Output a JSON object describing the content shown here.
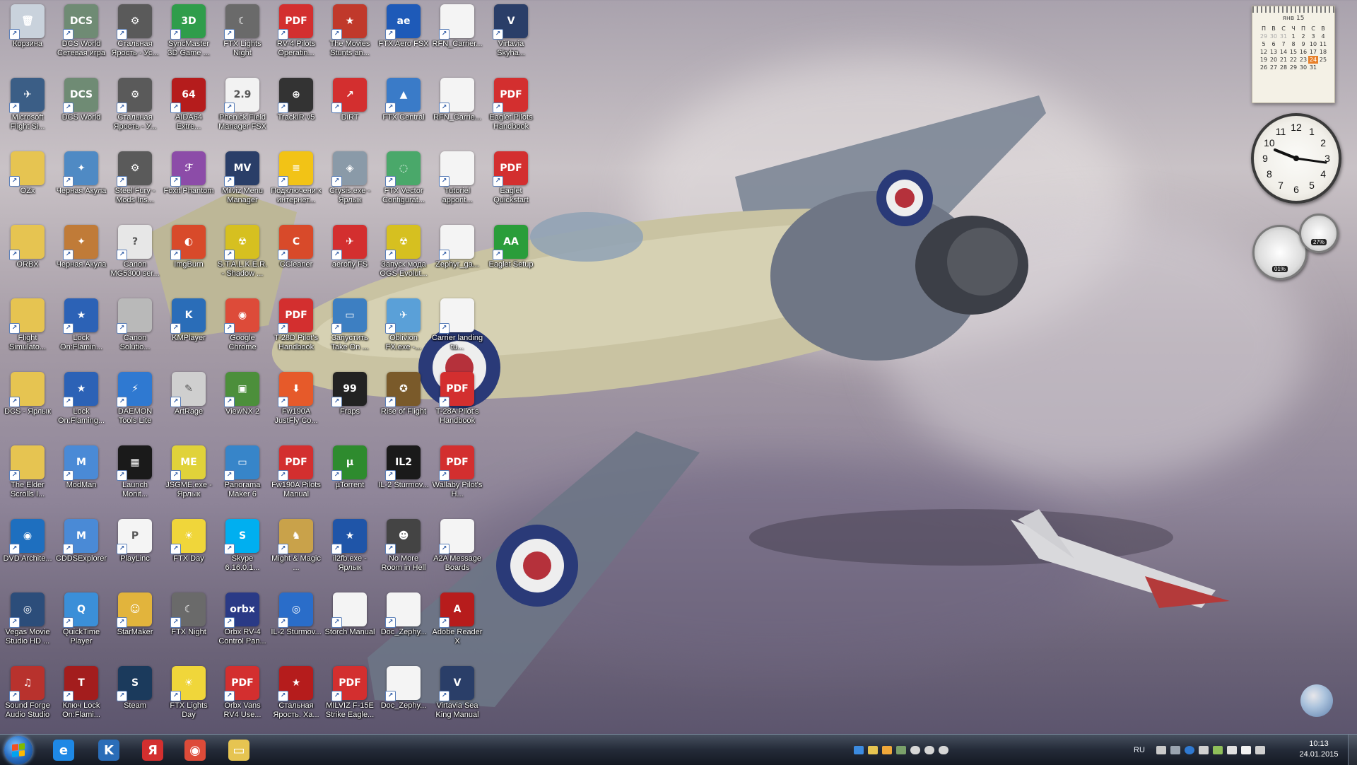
{
  "desktop": {
    "icons": [
      {
        "label": "Корзина",
        "color": "#c9d2dc",
        "glyph": "🗑"
      },
      {
        "label": "Microsoft Flight Si...",
        "color": "#3b5e86",
        "glyph": "✈"
      },
      {
        "label": "OZx",
        "color": "#e6c451",
        "glyph": ""
      },
      {
        "label": "ORBX",
        "color": "#e6c451",
        "glyph": ""
      },
      {
        "label": "Flight Simulato...",
        "color": "#e6c451",
        "glyph": ""
      },
      {
        "label": "DCS - Ярлык",
        "color": "#e6c451",
        "glyph": ""
      },
      {
        "label": "The Elder Scrolls I...",
        "color": "#e6c451",
        "glyph": ""
      },
      {
        "label": "DVD Archite...",
        "color": "#1e6fbf",
        "glyph": "◉"
      },
      {
        "label": "Vegas Movie Studio HD ...",
        "color": "#2c4d7a",
        "glyph": "◎"
      },
      {
        "label": "Sound Forge Audio Studio",
        "color": "#b8322d",
        "glyph": "♫"
      },
      {
        "label": "DCS World Сетевая игра",
        "color": "#6f8b74",
        "glyph": "DCS"
      },
      {
        "label": "DCS World",
        "color": "#6f8b74",
        "glyph": "DCS"
      },
      {
        "label": "Черная Акула",
        "color": "#4f8ac4",
        "glyph": "✦"
      },
      {
        "label": "Черная Акула",
        "color": "#c07b38",
        "glyph": "✦"
      },
      {
        "label": "Lock On:Flamin...",
        "color": "#2c62b6",
        "glyph": "★"
      },
      {
        "label": "Lock On:Flaming...",
        "color": "#2c62b6",
        "glyph": "★"
      },
      {
        "label": "ModMan",
        "color": "#4a8ad6",
        "glyph": "M"
      },
      {
        "label": "CDDSExplorer",
        "color": "#4a8ad6",
        "glyph": "M"
      },
      {
        "label": "QuickTime Player",
        "color": "#3b8fd8",
        "glyph": "Q"
      },
      {
        "label": "Ключ Lock On:Flami...",
        "color": "#a31d1d",
        "glyph": "T"
      },
      {
        "label": "Стальная Ярость - Ус...",
        "color": "#5a5a5a",
        "glyph": "⚙"
      },
      {
        "label": "Стальная Ярость - У...",
        "color": "#5a5a5a",
        "glyph": "⚙"
      },
      {
        "label": "Steel Fury - Mods Ins...",
        "color": "#5a5a5a",
        "glyph": "⚙"
      },
      {
        "label": "Canon MG5300 ser...",
        "color": "#e7e7e7",
        "glyph": "?"
      },
      {
        "label": "Canon Solutio...",
        "color": "#b9b9b9",
        "glyph": ""
      },
      {
        "label": "DAEMON Tools Lite",
        "color": "#2f79d1",
        "glyph": "⚡"
      },
      {
        "label": "Launch Monit...",
        "color": "#1a1a1a",
        "glyph": "▦"
      },
      {
        "label": "PlayLinc",
        "color": "#f4f4f4",
        "glyph": "P"
      },
      {
        "label": "StarMaker",
        "color": "#e2b43c",
        "glyph": "☺"
      },
      {
        "label": "Steam",
        "color": "#1b3a5c",
        "glyph": "S"
      },
      {
        "label": "SyncMaster 3D Game ...",
        "color": "#2f9d4b",
        "glyph": "3D"
      },
      {
        "label": "AIDA64 Extre...",
        "color": "#b51c1c",
        "glyph": "64"
      },
      {
        "label": "Foxit Phantom",
        "color": "#8c4ca8",
        "glyph": "ℱ"
      },
      {
        "label": "ImgBurn",
        "color": "#d84a2a",
        "glyph": "◐"
      },
      {
        "label": "KMPlayer",
        "color": "#2a6db8",
        "glyph": "K"
      },
      {
        "label": "ArtRage",
        "color": "#cfcfcf",
        "glyph": "✎"
      },
      {
        "label": "JSGME.exe - Ярлык",
        "color": "#e0d23a",
        "glyph": "ME"
      },
      {
        "label": "FTX Day",
        "color": "#f0d63a",
        "glyph": "☀"
      },
      {
        "label": "FTX Night",
        "color": "#6a6a6a",
        "glyph": "☾"
      },
      {
        "label": "FTX Lights Day",
        "color": "#f0d63a",
        "glyph": "☀"
      },
      {
        "label": "FTX Lights Night",
        "color": "#6a6a6a",
        "glyph": "☾"
      },
      {
        "label": "Phenick Field Manager FSX",
        "color": "#f2f2f2",
        "glyph": "2.9"
      },
      {
        "label": "Milviz Menu Manager",
        "color": "#2a3e68",
        "glyph": "MV"
      },
      {
        "label": "S.T.A.L.K.E.R. - Shadow ...",
        "color": "#d6c020",
        "glyph": "☢"
      },
      {
        "label": "Google Chrome",
        "color": "#dd4b39",
        "glyph": "◉"
      },
      {
        "label": "ViewNX 2",
        "color": "#4c8f3b",
        "glyph": "▣"
      },
      {
        "label": "Panorama Maker 6",
        "color": "#3785c9",
        "glyph": "▭"
      },
      {
        "label": "Skype 6.16.0.1...",
        "color": "#00aff0",
        "glyph": "S"
      },
      {
        "label": "Orbx RV-4 Control Pan...",
        "color": "#2a3a86",
        "glyph": "orbx"
      },
      {
        "label": "Orbx Vans RV4 Use...",
        "color": "#d32f2f",
        "glyph": "PDF"
      },
      {
        "label": "RV-4 Pilots Operatin...",
        "color": "#d32f2f",
        "glyph": "PDF"
      },
      {
        "label": "TrackIR v5",
        "color": "#333",
        "glyph": "⊕"
      },
      {
        "label": "Подключени к интернет...",
        "color": "#f2c316",
        "glyph": "≡"
      },
      {
        "label": "CCleaner",
        "color": "#d84a2a",
        "glyph": "C"
      },
      {
        "label": "T-28D Pilot's Handbook",
        "color": "#d32f2f",
        "glyph": "PDF"
      },
      {
        "label": "Fw190A JustFly Co...",
        "color": "#e65a2a",
        "glyph": "⬇"
      },
      {
        "label": "Fw190A Pilots Manual",
        "color": "#d32f2f",
        "glyph": "PDF"
      },
      {
        "label": "Might & Magic ...",
        "color": "#c9a24a",
        "glyph": "♞"
      },
      {
        "label": "IL-2 Sturmov...",
        "color": "#2a6dc9",
        "glyph": "◎"
      },
      {
        "label": "Стальная Ярость. Ха...",
        "color": "#b51c1c",
        "glyph": "★"
      },
      {
        "label": "The Movies Stunts an...",
        "color": "#c0392b",
        "glyph": "★"
      },
      {
        "label": "DiRT",
        "color": "#d32f2f",
        "glyph": "↗"
      },
      {
        "label": "Crysis.exe - Ярлык",
        "color": "#8a9aa8",
        "glyph": "◈"
      },
      {
        "label": "aerofly FS",
        "color": "#d32f2f",
        "glyph": "✈"
      },
      {
        "label": "Запустить Take On ...",
        "color": "#3d7fc2",
        "glyph": "▭"
      },
      {
        "label": "Fraps",
        "color": "#222",
        "glyph": "99"
      },
      {
        "label": "µTorrent",
        "color": "#2e8b2e",
        "glyph": "µ"
      },
      {
        "label": "il2fb.exe - Ярлык",
        "color": "#1f55a8",
        "glyph": "★"
      },
      {
        "label": "Storch Manual",
        "color": "#f4f4f4",
        "glyph": ""
      },
      {
        "label": "MILVIZ F-15E Strike Eagle...",
        "color": "#d32f2f",
        "glyph": "PDF"
      },
      {
        "label": "FTX Aero FSX",
        "color": "#1e5ab8",
        "glyph": "ae"
      },
      {
        "label": "FTX Central",
        "color": "#3a7bc8",
        "glyph": "▲"
      },
      {
        "label": "FTX Vector Configurat...",
        "color": "#4aa86a",
        "glyph": "◌"
      },
      {
        "label": "Запуск мода OGS Evolut...",
        "color": "#d6c020",
        "glyph": "☢"
      },
      {
        "label": "Oblivion FX.exe -...",
        "color": "#5aa0d8",
        "glyph": "✈"
      },
      {
        "label": "Rise of Flight",
        "color": "#7a5a2a",
        "glyph": "✪"
      },
      {
        "label": "IL-2 Sturmov...",
        "color": "#1a1a1a",
        "glyph": "IL2"
      },
      {
        "label": "No More Room in Hell",
        "color": "#444",
        "glyph": "☻"
      },
      {
        "label": "Doc_Zephy...",
        "color": "#f4f4f4",
        "glyph": ""
      },
      {
        "label": "Doc_Zephy...",
        "color": "#f4f4f4",
        "glyph": ""
      },
      {
        "label": "RFN_Carrier...",
        "color": "#f4f4f4",
        "glyph": ""
      },
      {
        "label": "RFN_Carrie...",
        "color": "#f4f4f4",
        "glyph": ""
      },
      {
        "label": "Tutoriel appont...",
        "color": "#f4f4f4",
        "glyph": ""
      },
      {
        "label": "Zephyr_ga...",
        "color": "#f4f4f4",
        "glyph": ""
      },
      {
        "label": "Carrier landing tu...",
        "color": "#f4f4f4",
        "glyph": ""
      },
      {
        "label": "T-28A Pilot's Handbook",
        "color": "#d32f2f",
        "glyph": "PDF"
      },
      {
        "label": "Wallaby Pilot's H...",
        "color": "#d32f2f",
        "glyph": "PDF"
      },
      {
        "label": "A2A Message Boards",
        "color": "#f4f4f4",
        "glyph": ""
      },
      {
        "label": "Adobe Reader X",
        "color": "#b71c1c",
        "glyph": "A"
      },
      {
        "label": "Virtavia Sea King Manual",
        "color": "#2a3e68",
        "glyph": "V"
      },
      {
        "label": "Virtavia Skyha...",
        "color": "#2a3e68",
        "glyph": "V"
      },
      {
        "label": "Eaglet Pilots Handbook",
        "color": "#d32f2f",
        "glyph": "PDF"
      },
      {
        "label": "Eaglet Quickstart",
        "color": "#d32f2f",
        "glyph": "PDF"
      },
      {
        "label": "Eaglet Setup",
        "color": "#2a9d3a",
        "glyph": "AA"
      }
    ]
  },
  "gadgets": {
    "calendar": {
      "month": "янв 15",
      "weekdays": [
        "П",
        "В",
        "С",
        "Ч",
        "П",
        "С",
        "В"
      ],
      "weeks": [
        [
          "29",
          "30",
          "31",
          "1",
          "2",
          "3",
          "4"
        ],
        [
          "5",
          "6",
          "7",
          "8",
          "9",
          "10",
          "11"
        ],
        [
          "12",
          "13",
          "14",
          "15",
          "16",
          "17",
          "18"
        ],
        [
          "19",
          "20",
          "21",
          "22",
          "23",
          "24",
          "25"
        ],
        [
          "26",
          "27",
          "28",
          "29",
          "30",
          "31",
          ""
        ]
      ],
      "today": "24"
    },
    "clock": {
      "numbers": [
        "12",
        "1",
        "2",
        "3",
        "4",
        "5",
        "6",
        "7",
        "8",
        "9",
        "10",
        "11"
      ],
      "time": "10:13"
    },
    "cpu_meter": {
      "cpu": "01%",
      "ram": "27%"
    }
  },
  "taskbar": {
    "pinned": [
      {
        "name": "ie",
        "color": "#1e88e5",
        "glyph": "e"
      },
      {
        "name": "kmplayer",
        "color": "#2a6db8",
        "glyph": "K"
      },
      {
        "name": "yandex",
        "color": "#d32f2f",
        "glyph": "Я"
      },
      {
        "name": "chrome",
        "color": "#dd4b39",
        "glyph": "◉"
      },
      {
        "name": "explorer",
        "color": "#e6c451",
        "glyph": "▭"
      }
    ],
    "language": "RU",
    "time": "10:13",
    "date": "24.01.2015"
  }
}
